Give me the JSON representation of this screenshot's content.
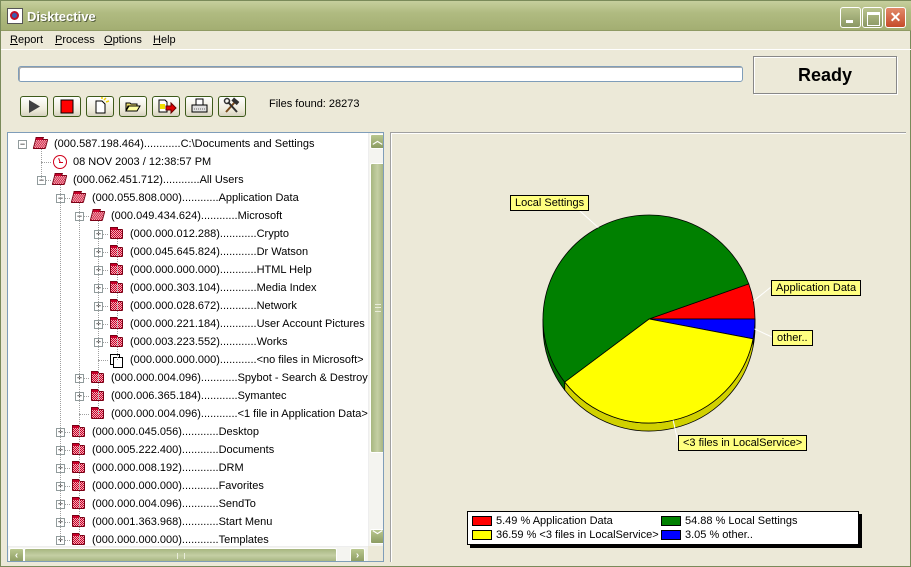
{
  "window": {
    "title": "Disktective",
    "controls": {
      "minimize": "minimize",
      "maximize": "maximize",
      "close": "close"
    }
  },
  "menu": [
    {
      "label": "Report"
    },
    {
      "label": "Process"
    },
    {
      "label": "Options"
    },
    {
      "label": "Help"
    }
  ],
  "status": {
    "progress_percent": 0,
    "state_label": "Ready",
    "files_found_label": "Files found: 28273"
  },
  "toolbar": [
    {
      "name": "start",
      "icon": "play-icon"
    },
    {
      "name": "stop",
      "icon": "stop-icon"
    },
    {
      "name": "new-report",
      "icon": "new-document-icon"
    },
    {
      "name": "open",
      "icon": "open-folder-icon"
    },
    {
      "name": "export",
      "icon": "export-icon"
    },
    {
      "name": "print",
      "icon": "printer-icon"
    },
    {
      "name": "settings",
      "icon": "tools-icon"
    }
  ],
  "tree": {
    "rows": [
      {
        "level": 0,
        "expander": "minus",
        "icon": "folder-open",
        "size": "(000.587.198.464)",
        "dots": "............",
        "name": "C:\\Documents and Settings"
      },
      {
        "level": 1,
        "expander": "none",
        "icon": "clock",
        "size": "",
        "dots": "",
        "name": "08 NOV 2003 / 12:38:57 PM"
      },
      {
        "level": 1,
        "expander": "minus",
        "icon": "folder-open",
        "size": "(000.062.451.712)",
        "dots": "............",
        "name": "All Users"
      },
      {
        "level": 2,
        "expander": "minus",
        "icon": "folder-open",
        "size": "(000.055.808.000)",
        "dots": "............",
        "name": "Application Data"
      },
      {
        "level": 3,
        "expander": "minus",
        "icon": "folder-open",
        "size": "(000.049.434.624)",
        "dots": "............",
        "name": "Microsoft"
      },
      {
        "level": 4,
        "expander": "plus",
        "icon": "folder",
        "size": "(000.000.012.288)",
        "dots": "............",
        "name": "Crypto"
      },
      {
        "level": 4,
        "expander": "plus",
        "icon": "folder",
        "size": "(000.045.645.824)",
        "dots": "............",
        "name": "Dr Watson"
      },
      {
        "level": 4,
        "expander": "plus",
        "icon": "folder",
        "size": "(000.000.000.000)",
        "dots": "............",
        "name": "HTML Help"
      },
      {
        "level": 4,
        "expander": "plus",
        "icon": "folder",
        "size": "(000.000.303.104)",
        "dots": "............",
        "name": "Media Index"
      },
      {
        "level": 4,
        "expander": "plus",
        "icon": "folder",
        "size": "(000.000.028.672)",
        "dots": "............",
        "name": "Network"
      },
      {
        "level": 4,
        "expander": "plus",
        "icon": "folder",
        "size": "(000.000.221.184)",
        "dots": "............",
        "name": "User Account Pictures"
      },
      {
        "level": 4,
        "expander": "plus",
        "icon": "folder",
        "size": "(000.003.223.552)",
        "dots": "............",
        "name": "Works"
      },
      {
        "level": 4,
        "expander": "none",
        "icon": "files",
        "size": "(000.000.000.000)",
        "dots": "............",
        "name": "<no files in Microsoft>"
      },
      {
        "level": 3,
        "expander": "plus",
        "icon": "folder",
        "size": "(000.000.004.096)",
        "dots": "............",
        "name": "Spybot - Search & Destroy"
      },
      {
        "level": 3,
        "expander": "plus",
        "icon": "folder",
        "size": "(000.006.365.184)",
        "dots": "............",
        "name": "Symantec"
      },
      {
        "level": 3,
        "expander": "none",
        "icon": "folder",
        "size": "(000.000.004.096)",
        "dots": "............",
        "name": "<1 file in Application Data>"
      },
      {
        "level": 2,
        "expander": "plus",
        "icon": "folder",
        "size": "(000.000.045.056)",
        "dots": "............",
        "name": "Desktop"
      },
      {
        "level": 2,
        "expander": "plus",
        "icon": "folder",
        "size": "(000.005.222.400)",
        "dots": "............",
        "name": "Documents"
      },
      {
        "level": 2,
        "expander": "plus",
        "icon": "folder",
        "size": "(000.000.008.192)",
        "dots": "............",
        "name": "DRM"
      },
      {
        "level": 2,
        "expander": "plus",
        "icon": "folder",
        "size": "(000.000.000.000)",
        "dots": "............",
        "name": "Favorites"
      },
      {
        "level": 2,
        "expander": "plus",
        "icon": "folder",
        "size": "(000.000.004.096)",
        "dots": "............",
        "name": "SendTo"
      },
      {
        "level": 2,
        "expander": "plus",
        "icon": "folder",
        "size": "(000.001.363.968)",
        "dots": "............",
        "name": "Start Menu"
      },
      {
        "level": 2,
        "expander": "plus",
        "icon": "folder",
        "size": "(000.000.000.000)",
        "dots": "............",
        "name": "Templates"
      }
    ]
  },
  "chart_data": {
    "type": "pie",
    "title": "",
    "slices": [
      {
        "label": "Application Data",
        "value": 5.49,
        "color": "#ff0000",
        "legend": "5.49 % Application Data"
      },
      {
        "label": "Local Settings",
        "value": 54.88,
        "color": "#008000",
        "legend": "54.88 % Local Settings"
      },
      {
        "label": "<3 files in LocalService>",
        "value": 36.59,
        "color": "#ffff00",
        "legend": "36.59 % <3 files in LocalService>"
      },
      {
        "label": "other..",
        "value": 3.05,
        "color": "#0000ff",
        "legend": "3.05 % other.."
      }
    ],
    "legend_placement": "bottom",
    "style": "3d-tilted"
  }
}
